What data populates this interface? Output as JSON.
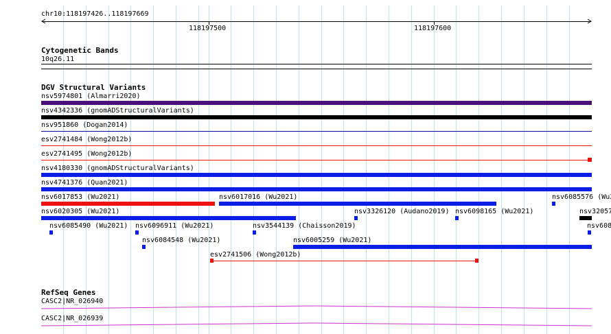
{
  "ruler": {
    "location": "chr10:118197426..118197669",
    "tick_labels": [
      "118197500",
      "118197600"
    ]
  },
  "tracks": {
    "cytobands": {
      "title": "Cytogenetic Bands",
      "band": "10q26.11"
    },
    "dgv": {
      "title": "DGV Structural Variants",
      "colors": {
        "purple": "#4b0f7a",
        "black": "#000000",
        "navy": "#0b0b99",
        "red": "#ee1111",
        "blue": "#0a1ee6"
      },
      "features": [
        {
          "label": "nsv5974801 (Almarri2020)",
          "color": "purple"
        },
        {
          "label": "nsv4342336 (gnomADStructuralVariants)",
          "color": "black"
        },
        {
          "label": "nsv951860 (Dogan2014)",
          "color": "navy"
        },
        {
          "label": "esv2741484 (Wong2012b)",
          "color": "red"
        },
        {
          "label": "esv2741495 (Wong2012b)",
          "color": "red"
        },
        {
          "label": "nsv4180330 (gnomADStructuralVariants)",
          "color": "blue"
        },
        {
          "label": "nsv4741376 (Quan2021)",
          "color": "blue"
        },
        {
          "label": "nsv6017853 (Wu2021)",
          "color": "red"
        },
        {
          "label": "nsv6017016 (Wu2021)",
          "color": "blue"
        },
        {
          "label": "nsv6085576 (Wu2",
          "color": "blue"
        },
        {
          "label": "nsv6020305 (Wu2021)",
          "color": "blue"
        },
        {
          "label": "nsv3326120 (Audano2019)",
          "color": "blue"
        },
        {
          "label": "nsv6098165 (Wu2021)",
          "color": "blue"
        },
        {
          "label": "nsv32057",
          "color": "black"
        },
        {
          "label": "nsv6085490 (Wu2021)",
          "color": "blue"
        },
        {
          "label": "nsv6096911 (Wu2021)",
          "color": "blue"
        },
        {
          "label": "nsv3544139 (Chaisson2019)",
          "color": "blue"
        },
        {
          "label": "nsv608",
          "color": "blue"
        },
        {
          "label": "nsv6084548 (Wu2021)",
          "color": "blue"
        },
        {
          "label": "nsv6005259 (Wu2021)",
          "color": "blue"
        },
        {
          "label": "esv2741506 (Wong2012b)",
          "color": "red"
        }
      ]
    },
    "refseq": {
      "title": "RefSeq Genes",
      "color": "#cc33cc",
      "genes": [
        "CASC2|NR_026940",
        "CASC2|NR_026939"
      ]
    }
  }
}
